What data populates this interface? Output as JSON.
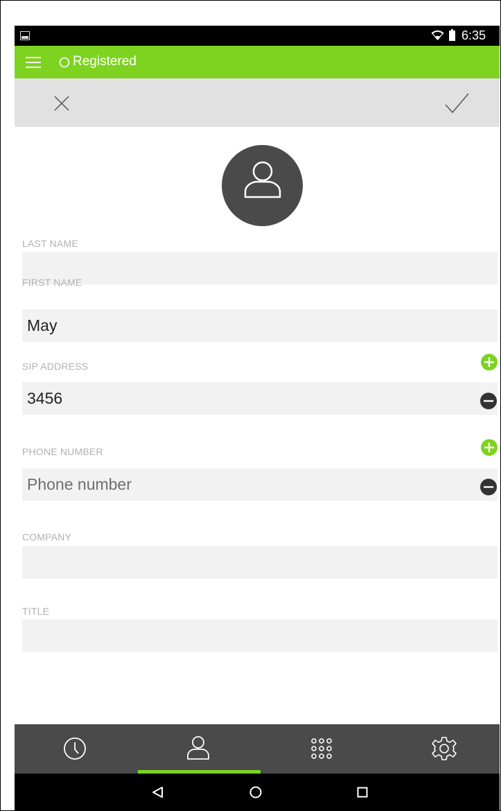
{
  "status_bar": {
    "time": "6:35"
  },
  "app_bar": {
    "status_label": "Registered"
  },
  "form": {
    "last_name": {
      "label": "LAST NAME",
      "value": ""
    },
    "first_name": {
      "label": "FIRST NAME",
      "value": "May"
    },
    "sip_address": {
      "label": "SIP ADDRESS",
      "value": "3456"
    },
    "phone_number": {
      "label": "PHONE NUMBER",
      "value": "",
      "placeholder": "Phone number"
    },
    "company": {
      "label": "COMPANY",
      "value": ""
    },
    "title": {
      "label": "TITLE",
      "value": ""
    }
  },
  "bottom_nav": {
    "items": [
      {
        "name": "history",
        "icon": "clock-icon",
        "active": false
      },
      {
        "name": "contacts",
        "icon": "person-icon",
        "active": true
      },
      {
        "name": "dialer",
        "icon": "dialpad-icon",
        "active": false
      },
      {
        "name": "settings",
        "icon": "gear-icon",
        "active": false
      }
    ]
  },
  "colors": {
    "accent": "#7ed321",
    "nav_bg": "#4a4a4a",
    "avatar_bg": "#4a4a4a",
    "field_bg": "#f2f2f2"
  }
}
